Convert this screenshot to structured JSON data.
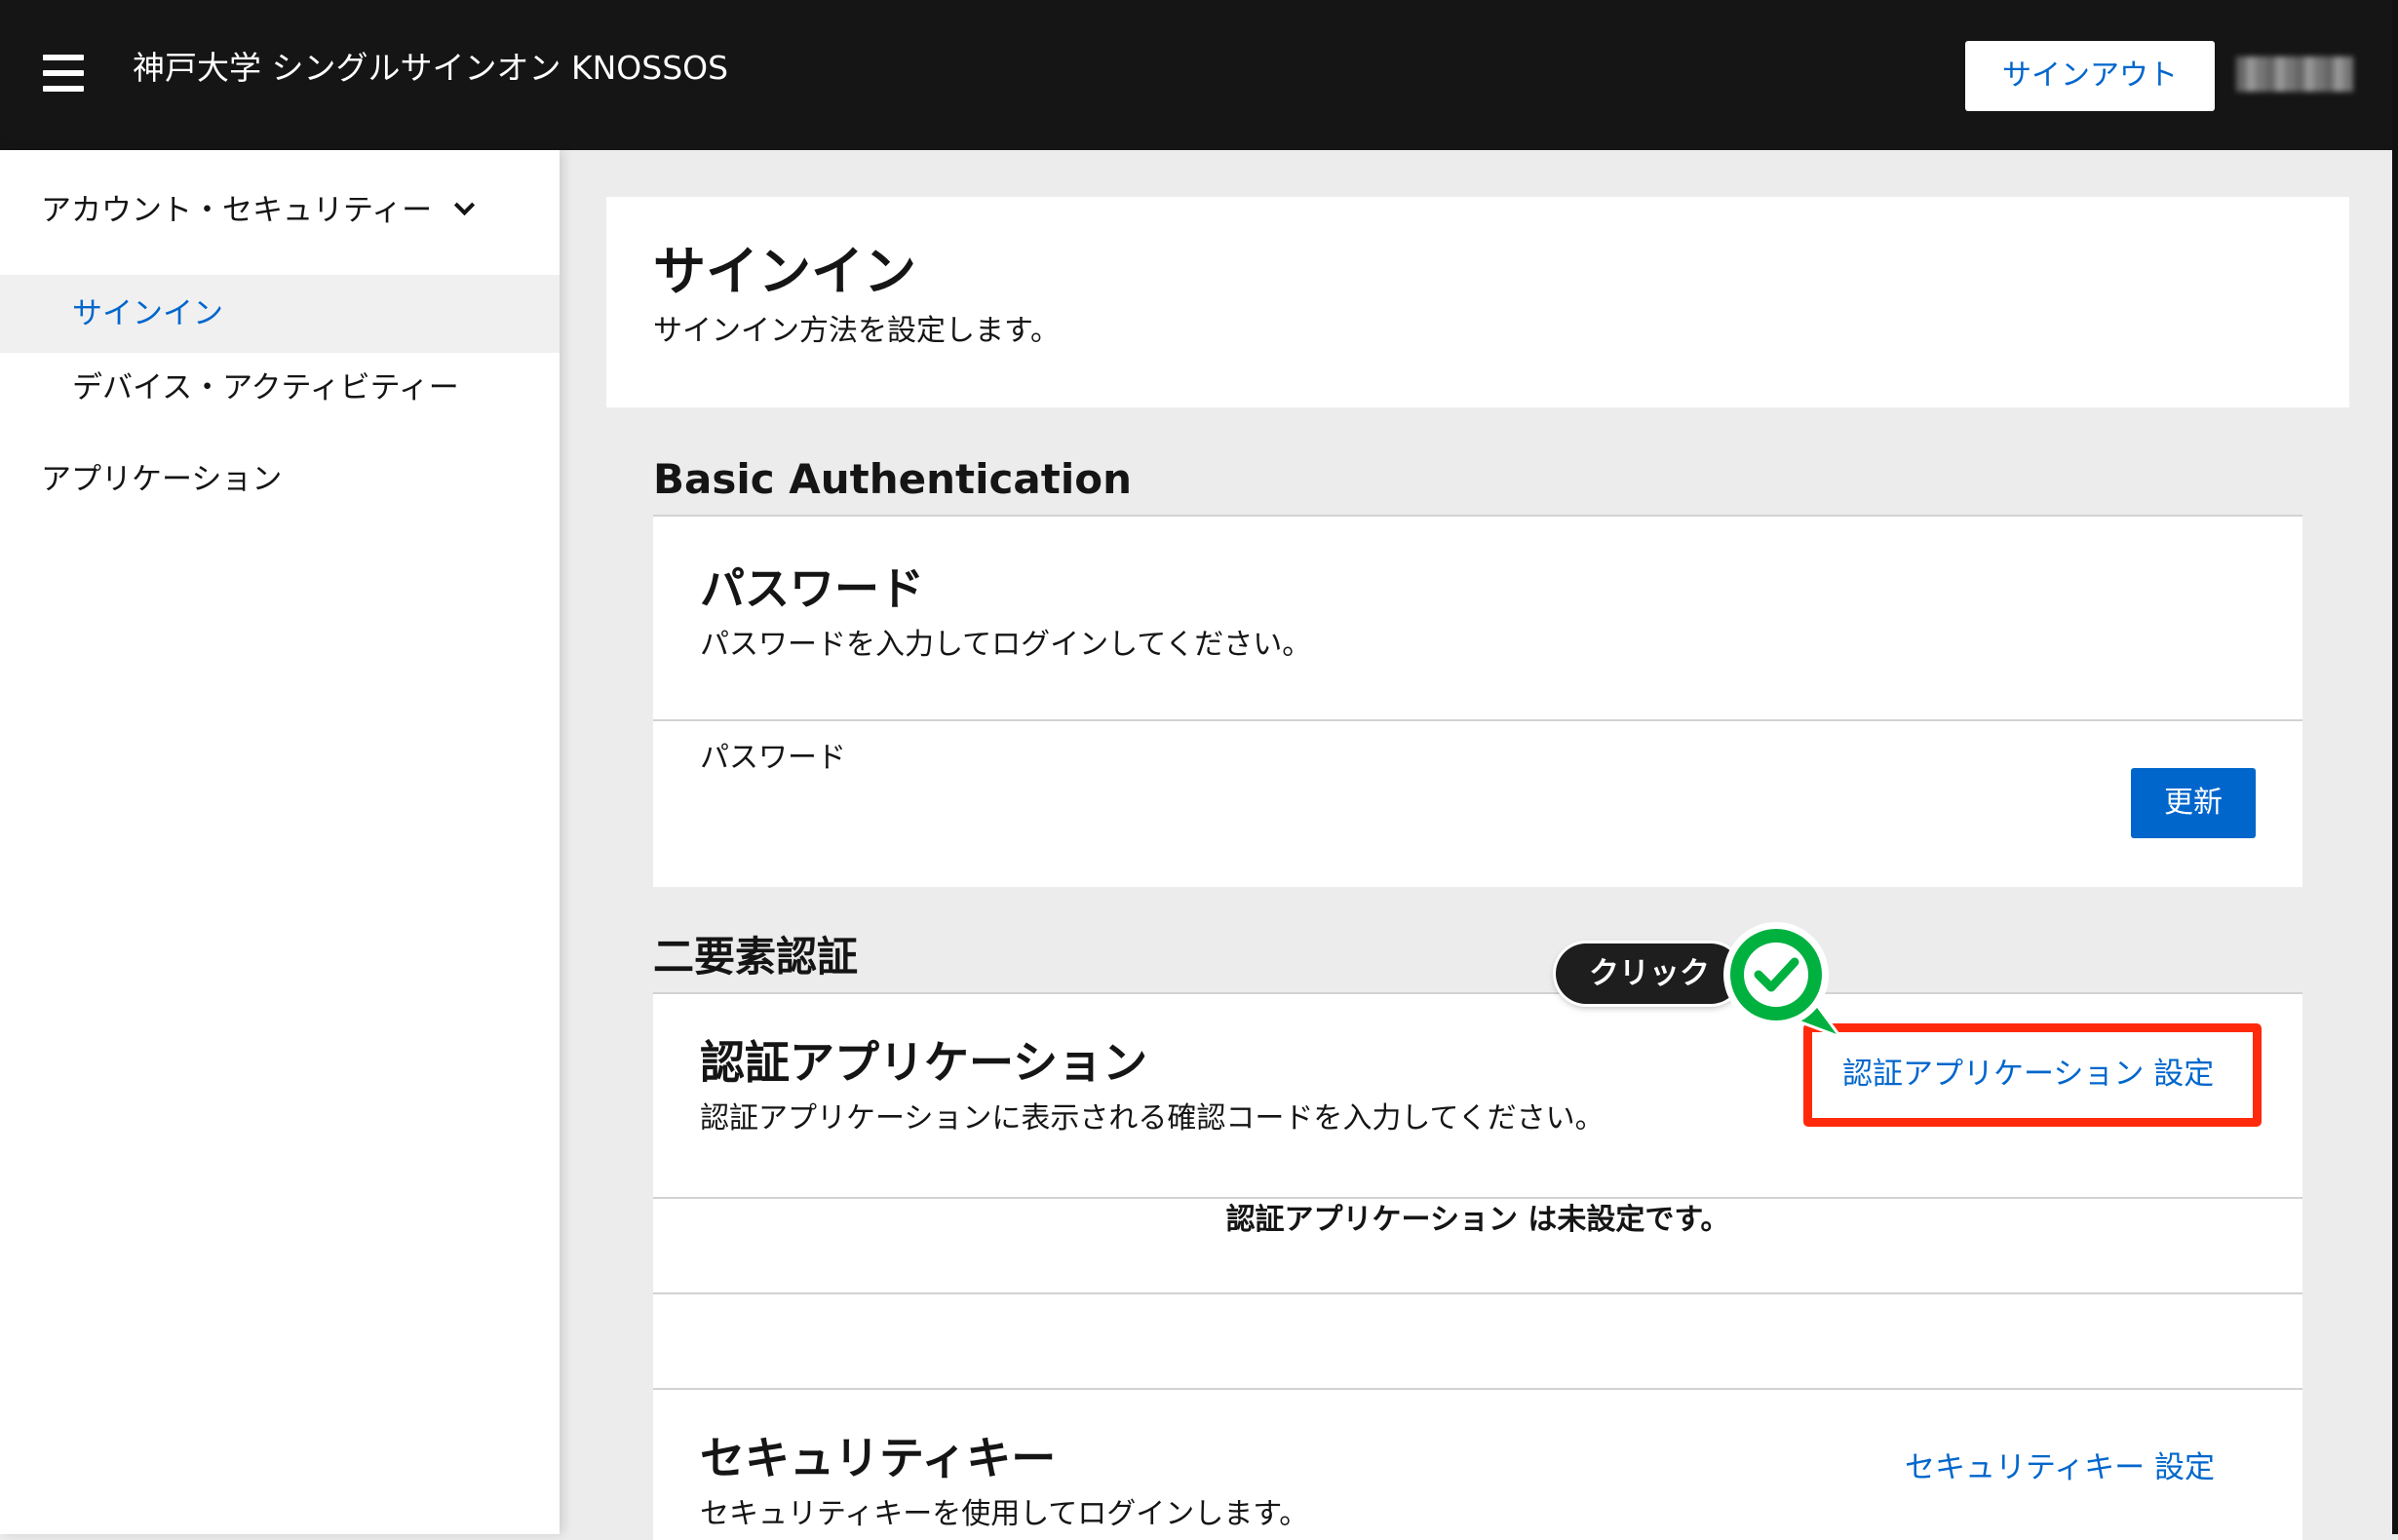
{
  "header": {
    "app_title": "神戸大学 シングルサインオン KNOSSOS",
    "signout_label": "サインアウト"
  },
  "sidebar": {
    "group_label": "アカウント・セキュリティー",
    "items": [
      {
        "label": "サインイン",
        "active": true
      },
      {
        "label": "デバイス・アクティビティー",
        "active": false
      }
    ],
    "applications_label": "アプリケーション"
  },
  "page": {
    "title": "サインイン",
    "subtitle": "サインイン方法を設定します。"
  },
  "basic_auth": {
    "section_title": "Basic Authentication",
    "card_title": "パスワード",
    "card_desc": "パスワードを入力してログインしてください。",
    "row_label": "パスワード",
    "update_label": "更新"
  },
  "two_factor": {
    "section_title": "二要素認証",
    "otp": {
      "card_title": "認証アプリケーション",
      "card_desc": "認証アプリケーションに表示される確認コードを入力してください。",
      "setup_link": "認証アプリケーション 設定",
      "status": "認証アプリケーション は未設定です。"
    },
    "security_key": {
      "card_title": "セキュリティキー",
      "card_desc": "セキュリティキーを使用してログインします。",
      "setup_link": "セキュリティキー 設定"
    }
  },
  "annotation": {
    "callout_label": "クリック",
    "highlight_color": "#ff2a0c",
    "marker_color": "#00b140"
  },
  "colors": {
    "accent": "#0066cc",
    "header_bg": "#151515",
    "page_bg": "#ececec"
  }
}
